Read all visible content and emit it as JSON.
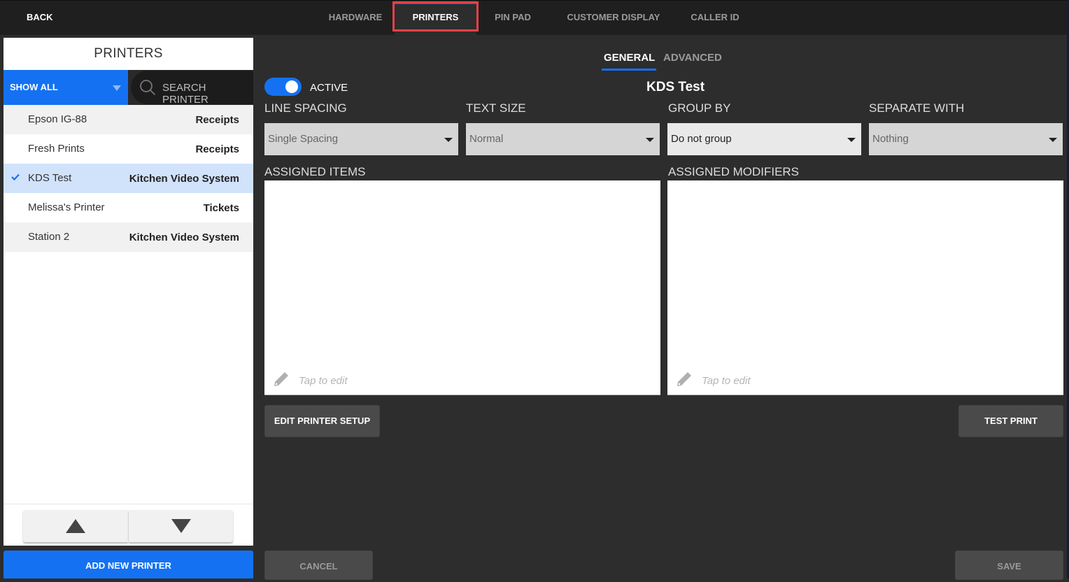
{
  "topbar": {
    "back_label": "BACK",
    "tabs": [
      {
        "label": "HARDWARE",
        "active": false
      },
      {
        "label": "PRINTERS",
        "active": true
      },
      {
        "label": "PIN PAD",
        "active": false
      },
      {
        "label": "CUSTOMER DISPLAY",
        "active": false
      },
      {
        "label": "CALLER ID",
        "active": false
      }
    ]
  },
  "sidebar": {
    "title": "PRINTERS",
    "filter_label": "SHOW ALL",
    "search_placeholder": "SEARCH PRINTER",
    "printers": [
      {
        "name": "Epson IG-88",
        "type": "Receipts",
        "selected": false
      },
      {
        "name": "Fresh Prints",
        "type": "Receipts",
        "selected": false
      },
      {
        "name": "KDS Test",
        "type": "Kitchen Video System",
        "selected": true
      },
      {
        "name": "Melissa's Printer",
        "type": "Tickets",
        "selected": false
      },
      {
        "name": "Station 2",
        "type": "Kitchen Video System",
        "selected": false
      }
    ],
    "add_button_label": "ADD NEW PRINTER"
  },
  "main": {
    "tabs": [
      {
        "label": "GENERAL",
        "active": true
      },
      {
        "label": "ADVANCED",
        "active": false
      }
    ],
    "active_toggle": {
      "label": "ACTIVE",
      "on": true
    },
    "printer_name": "KDS Test",
    "fields": [
      {
        "label": "LINE SPACING",
        "value": "Single Spacing"
      },
      {
        "label": "TEXT SIZE",
        "value": "Normal"
      },
      {
        "label": "GROUP BY",
        "value": "Do not group"
      },
      {
        "label": "SEPARATE WITH",
        "value": "Nothing"
      }
    ],
    "assigned_items": {
      "label": "ASSIGNED ITEMS",
      "placeholder": "Tap to edit"
    },
    "assigned_modifiers": {
      "label": "ASSIGNED MODIFIERS",
      "placeholder": "Tap to edit"
    },
    "edit_setup_label": "EDIT PRINTER SETUP",
    "test_print_label": "TEST PRINT",
    "cancel_label": "CANCEL",
    "save_label": "SAVE"
  },
  "colors": {
    "accent": "#1472f2",
    "highlight_outline": "#e8424a",
    "selected_row": "#d1e2fb"
  }
}
